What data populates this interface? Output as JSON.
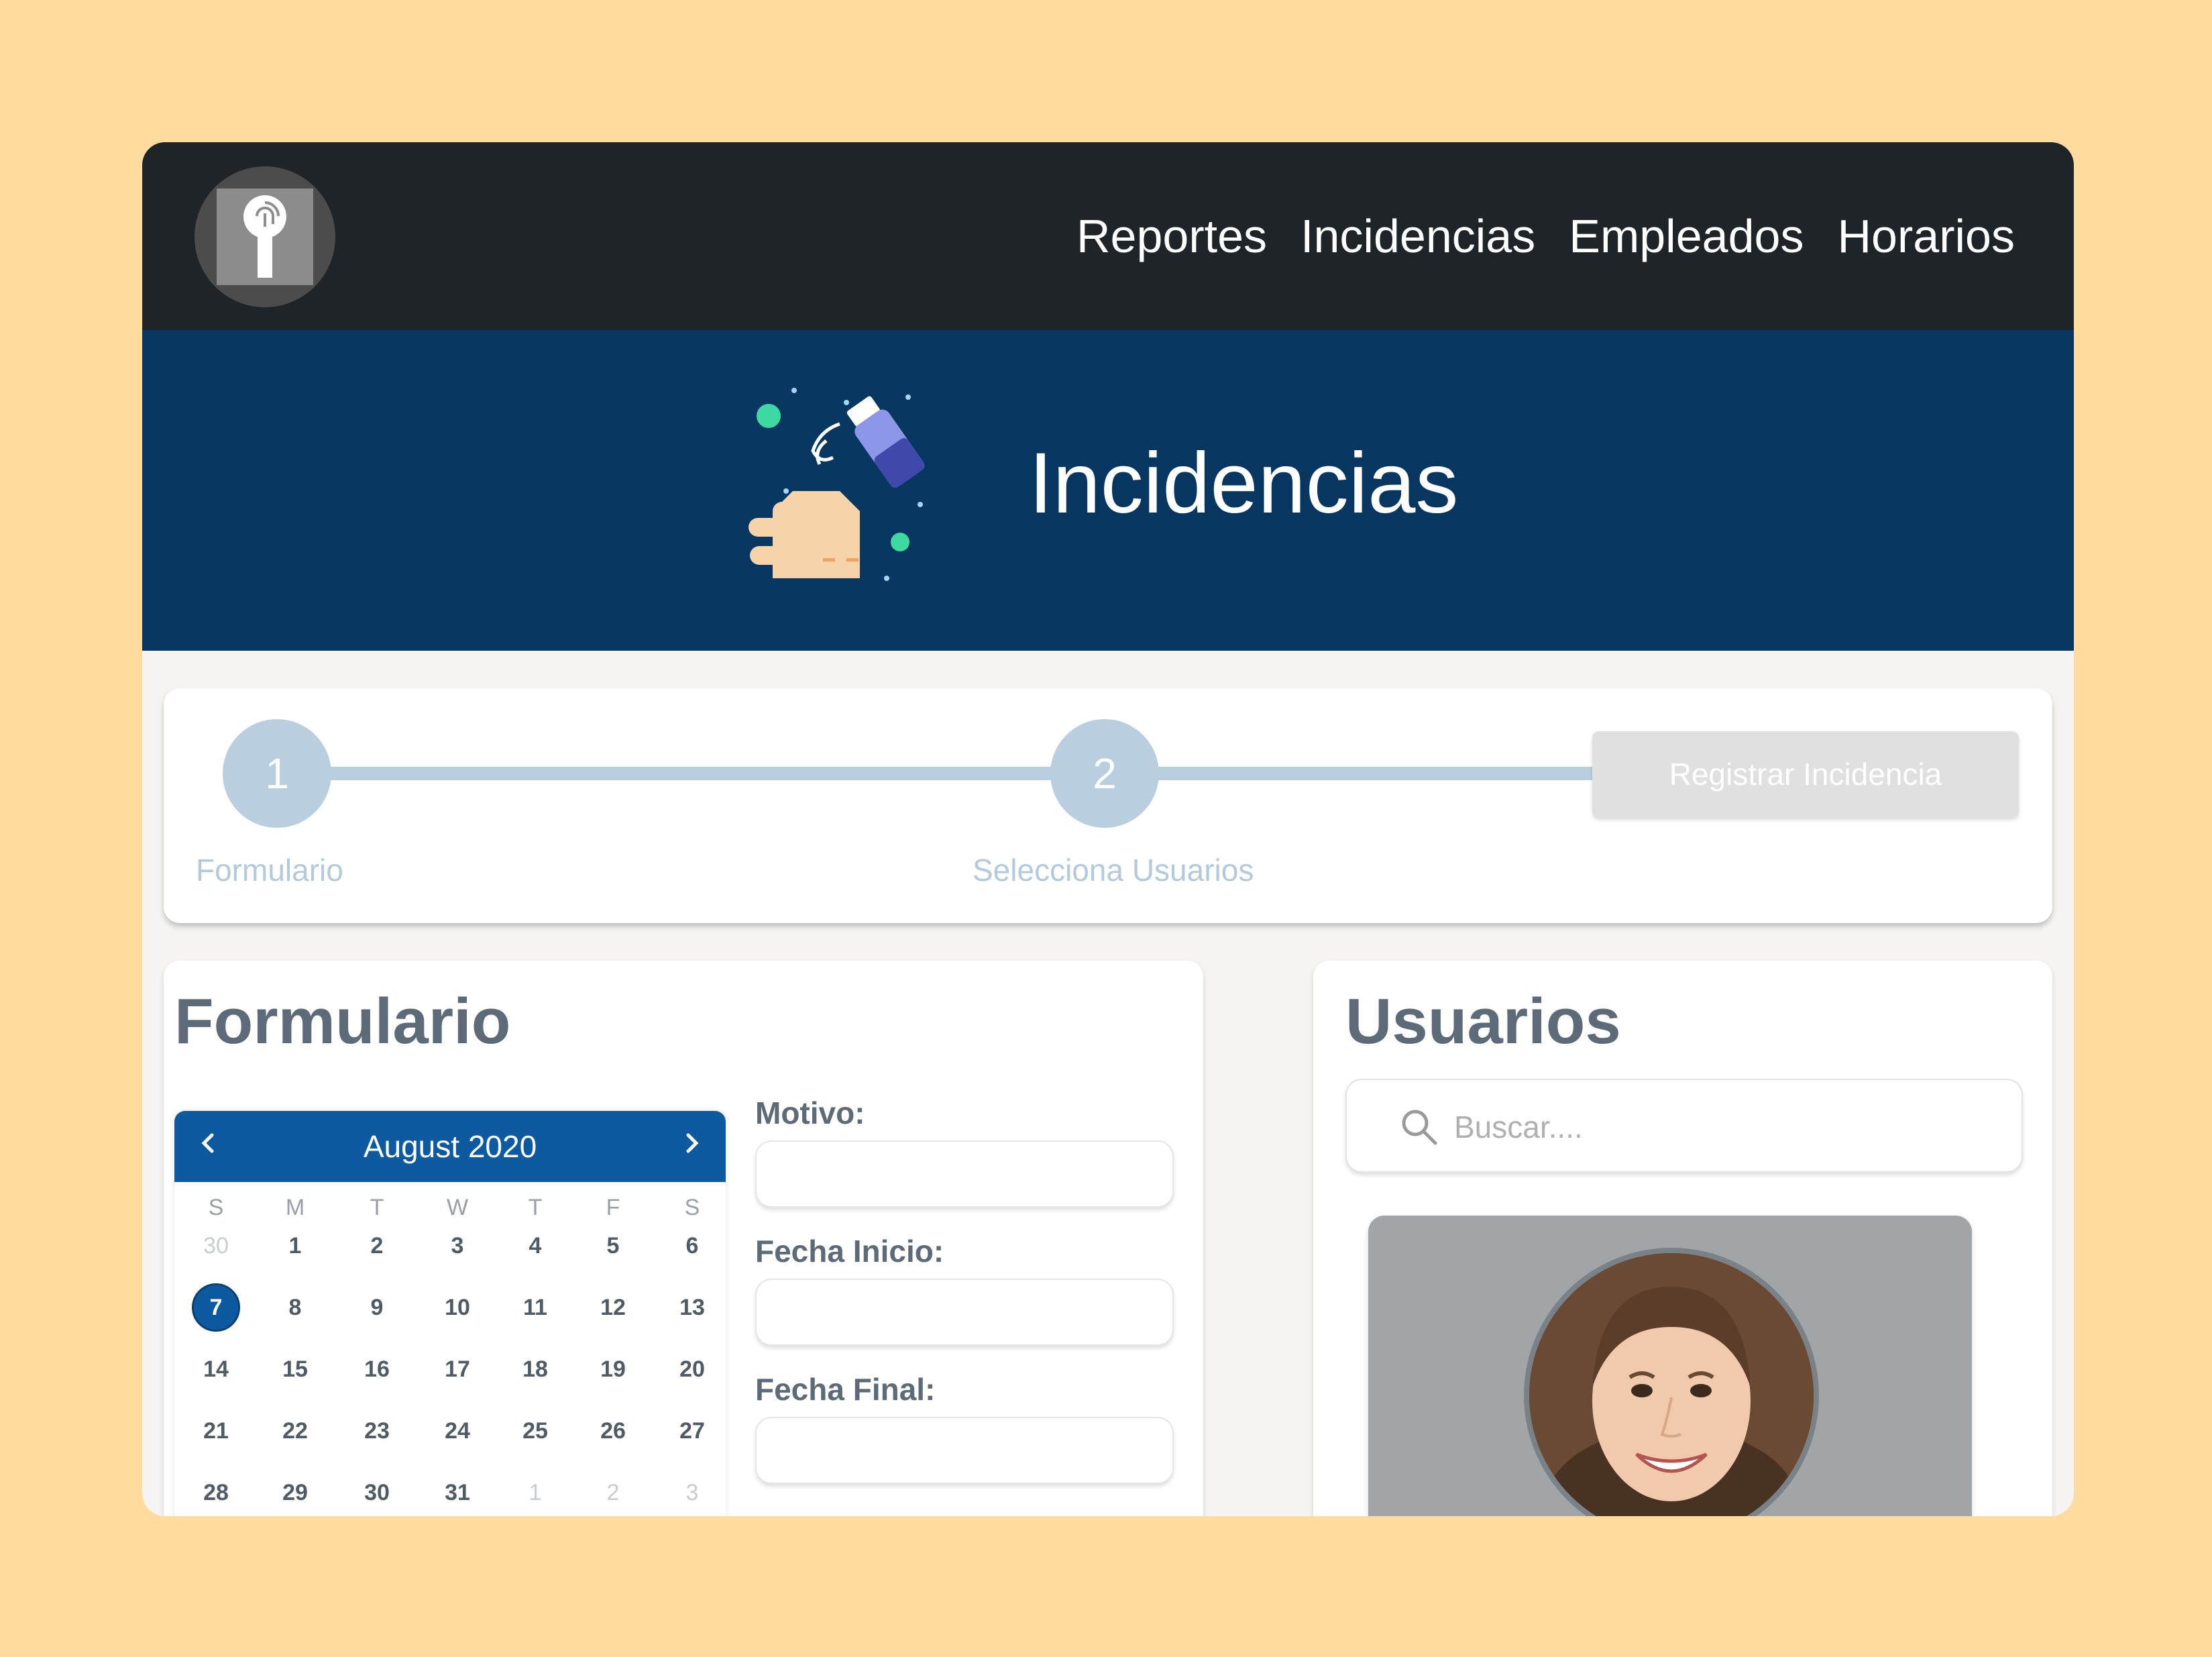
{
  "nav": {
    "links": [
      "Reportes",
      "Incidencias",
      "Empleados",
      "Horarios"
    ]
  },
  "hero": {
    "title": "Incidencias",
    "illustration_icon": "hand-sanitizer-icon"
  },
  "stepper": {
    "steps": [
      {
        "number": "1",
        "label": "Formulario"
      },
      {
        "number": "2",
        "label": "Selecciona Usuarios"
      }
    ],
    "register_label": "Registrar Incidencia"
  },
  "form": {
    "title": "Formulario",
    "calendar": {
      "month": "August 2020",
      "weekdays": [
        "S",
        "M",
        "T",
        "W",
        "T",
        "F",
        "S"
      ],
      "weeks": [
        [
          "30",
          "1",
          "2",
          "3",
          "4",
          "5",
          "6"
        ],
        [
          "7",
          "8",
          "9",
          "10",
          "11",
          "12",
          "13"
        ],
        [
          "14",
          "15",
          "16",
          "17",
          "18",
          "19",
          "20"
        ],
        [
          "21",
          "22",
          "23",
          "24",
          "25",
          "26",
          "27"
        ],
        [
          "28",
          "29",
          "30",
          "31",
          "1",
          "2",
          "3"
        ]
      ],
      "selected_day": "7"
    },
    "fields": [
      {
        "label": "Motivo:",
        "value": ""
      },
      {
        "label": "Fecha Inicio:",
        "value": ""
      },
      {
        "label": "Fecha Final:",
        "value": ""
      }
    ]
  },
  "users": {
    "title": "Usuarios",
    "search_placeholder": "Buscar...."
  },
  "colors": {
    "page_bg": "#ffdb9d",
    "topbar": "#1e2427",
    "hero": "#073761",
    "accent": "#0e5aa0",
    "step": "#b9cfe0"
  }
}
